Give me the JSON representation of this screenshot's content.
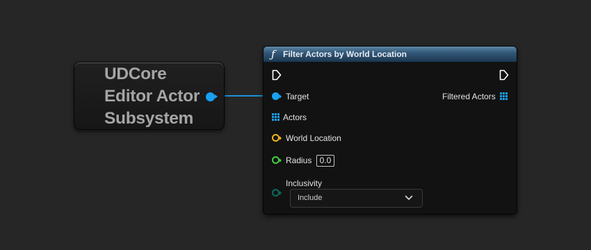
{
  "self_node": {
    "title_lines": [
      "UDCore",
      "Editor Actor",
      "Subsystem"
    ],
    "pin_color": "#1aa0f0"
  },
  "function_node": {
    "icon": "function-f-icon",
    "title": "Filter Actors by World Location",
    "header_color": "#34597a",
    "inputs": {
      "target_label": "Target",
      "actors_label": "Actors",
      "world_location_label": "World Location",
      "radius_label": "Radius",
      "radius_value": "0.0",
      "inclusivity_label": "Inclusivity",
      "inclusivity_value": "Include"
    },
    "outputs": {
      "filtered_actors_label": "Filtered Actors"
    },
    "pin_colors": {
      "object": "#1aa0f0",
      "vector": "#f0b41c",
      "float": "#3fd23f",
      "enum": "#0b6e5e",
      "exec": "#ffffff"
    }
  }
}
